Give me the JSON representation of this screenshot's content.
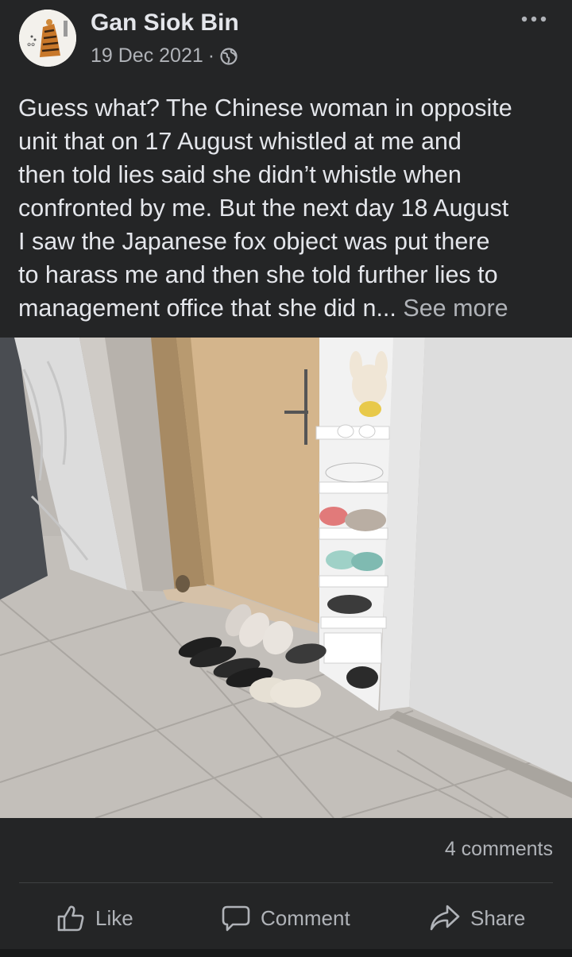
{
  "post": {
    "author": "Gan Siok Bin",
    "date": "19 Dec 2021",
    "separator": "·",
    "privacy_icon": "globe-icon",
    "more_icon": "more-options-icon",
    "text_lines": [
      "Guess what? The Chinese woman in opposite",
      "unit that on 17 August whistled at me and",
      "then told lies said she didn’t whistle when",
      "confronted by me. But the next day 18 August",
      "I saw the Japanese fox object was put there",
      "to harass me and then she told further  lies to",
      "management office that she did n..."
    ],
    "see_more": "See more"
  },
  "footer": {
    "comments_count": "4 comments",
    "like_label": "Like",
    "comment_label": "Comment",
    "share_label": "Share"
  },
  "colors": {
    "background": "#242526",
    "text_primary": "#e4e6eb",
    "text_secondary": "#b0b3b8",
    "divider": "#3e4042"
  }
}
